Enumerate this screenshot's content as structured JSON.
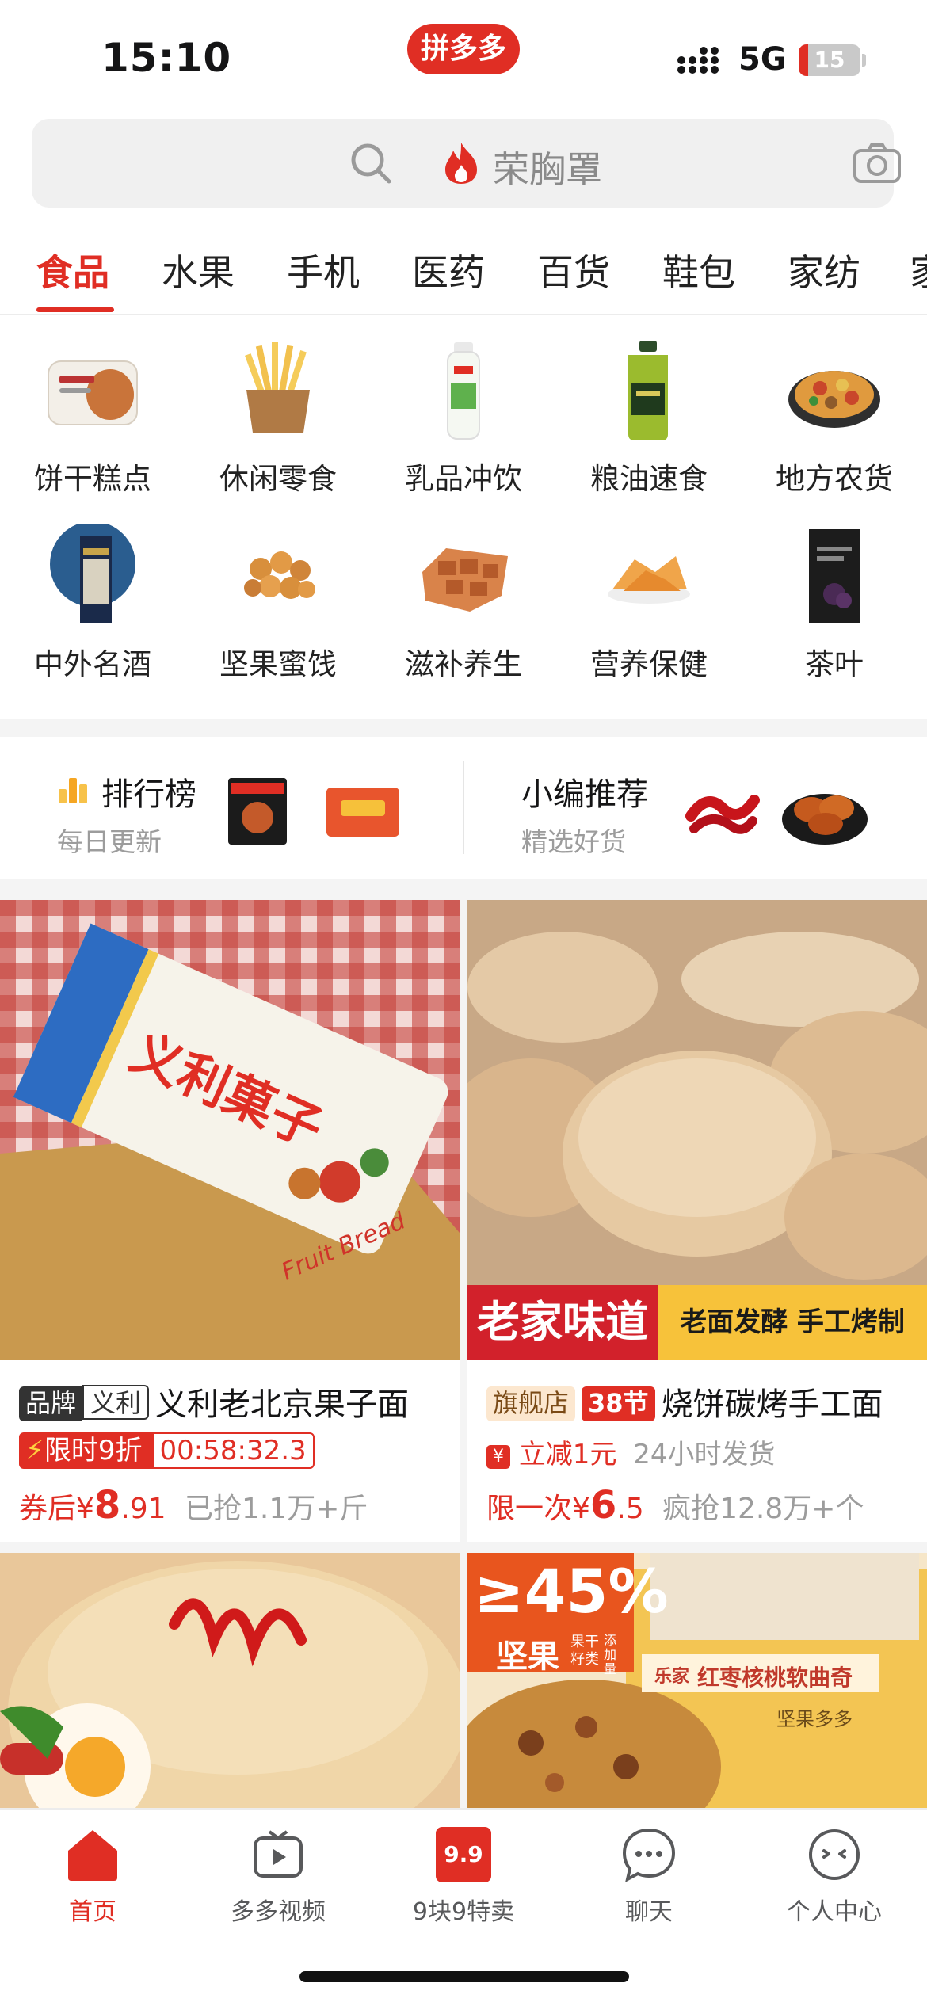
{
  "status": {
    "time": "15:10",
    "app_logo": "拼多多",
    "network": "5G",
    "battery": "15",
    "battery_level": 0.15
  },
  "search": {
    "query": "荣胸罩",
    "icon": "search-icon",
    "camera_icon": "camera-icon"
  },
  "tabs": [
    "食品",
    "水果",
    "手机",
    "医药",
    "百货",
    "鞋包",
    "家纺",
    "家"
  ],
  "categories": [
    {
      "label": "饼干糕点",
      "icon": "bread-icon"
    },
    {
      "label": "休闲零食",
      "icon": "fries-icon"
    },
    {
      "label": "乳品冲饮",
      "icon": "drink-bottle-icon"
    },
    {
      "label": "粮油速食",
      "icon": "oil-bottle-icon"
    },
    {
      "label": "地方农货",
      "icon": "dish-icon"
    },
    {
      "label": "中外名酒",
      "icon": "whisky-icon"
    },
    {
      "label": "坚果蜜饯",
      "icon": "nuts-icon"
    },
    {
      "label": "滋补养生",
      "icon": "cake-icon"
    },
    {
      "label": "营养保健",
      "icon": "chips-icon"
    },
    {
      "label": "茶叶",
      "icon": "tea-bag-icon"
    }
  ],
  "rank": {
    "left": {
      "title": "排行榜",
      "subtitle": "每日更新"
    },
    "right": {
      "title": "小编推荐",
      "subtitle": "精选好货"
    }
  },
  "products": [
    {
      "brand_badge": "品牌",
      "brand_name": "义利",
      "title": "义利老北京果子面",
      "photo_text": [
        "义利菓子",
        "Fruit Bread"
      ],
      "promo": "限时9折",
      "countdown": "00:58:32.3",
      "price_prefix": "券后¥",
      "price_int": "8",
      "price_dec": ".91",
      "sold": "已抢1.1万+斤"
    },
    {
      "shop_badge": "旗舰店",
      "event_badge": "38节",
      "title": "烧饼碳烤手工面",
      "photo_banner_left": "老家味道",
      "photo_banner_right": "老面发酵 手工烤制",
      "coupon": "立减1元",
      "delivery": "24小时发货",
      "price_prefix": "限一次¥",
      "price_int": "6",
      "price_dec": ".5",
      "sold": "疯抢12.8万+个"
    },
    {
      "photo_text": []
    },
    {
      "photo_text": [
        "≥45%",
        "坚果",
        "果干",
        "籽类",
        "添加量",
        "乐家",
        "红枣核桃软曲奇",
        "坚果多多"
      ]
    }
  ],
  "bottom_nav": [
    {
      "label": "首页",
      "icon": "home-icon",
      "active": true
    },
    {
      "label": "多多视频",
      "icon": "video-icon"
    },
    {
      "label": "9块9特卖",
      "icon": "nine-nine-icon",
      "icon_text": "9.9"
    },
    {
      "label": "聊天",
      "icon": "chat-icon"
    },
    {
      "label": "个人中心",
      "icon": "profile-icon"
    }
  ],
  "colors": {
    "brand": "#e02e24",
    "text": "#151516",
    "muted": "#9c9c9c"
  }
}
